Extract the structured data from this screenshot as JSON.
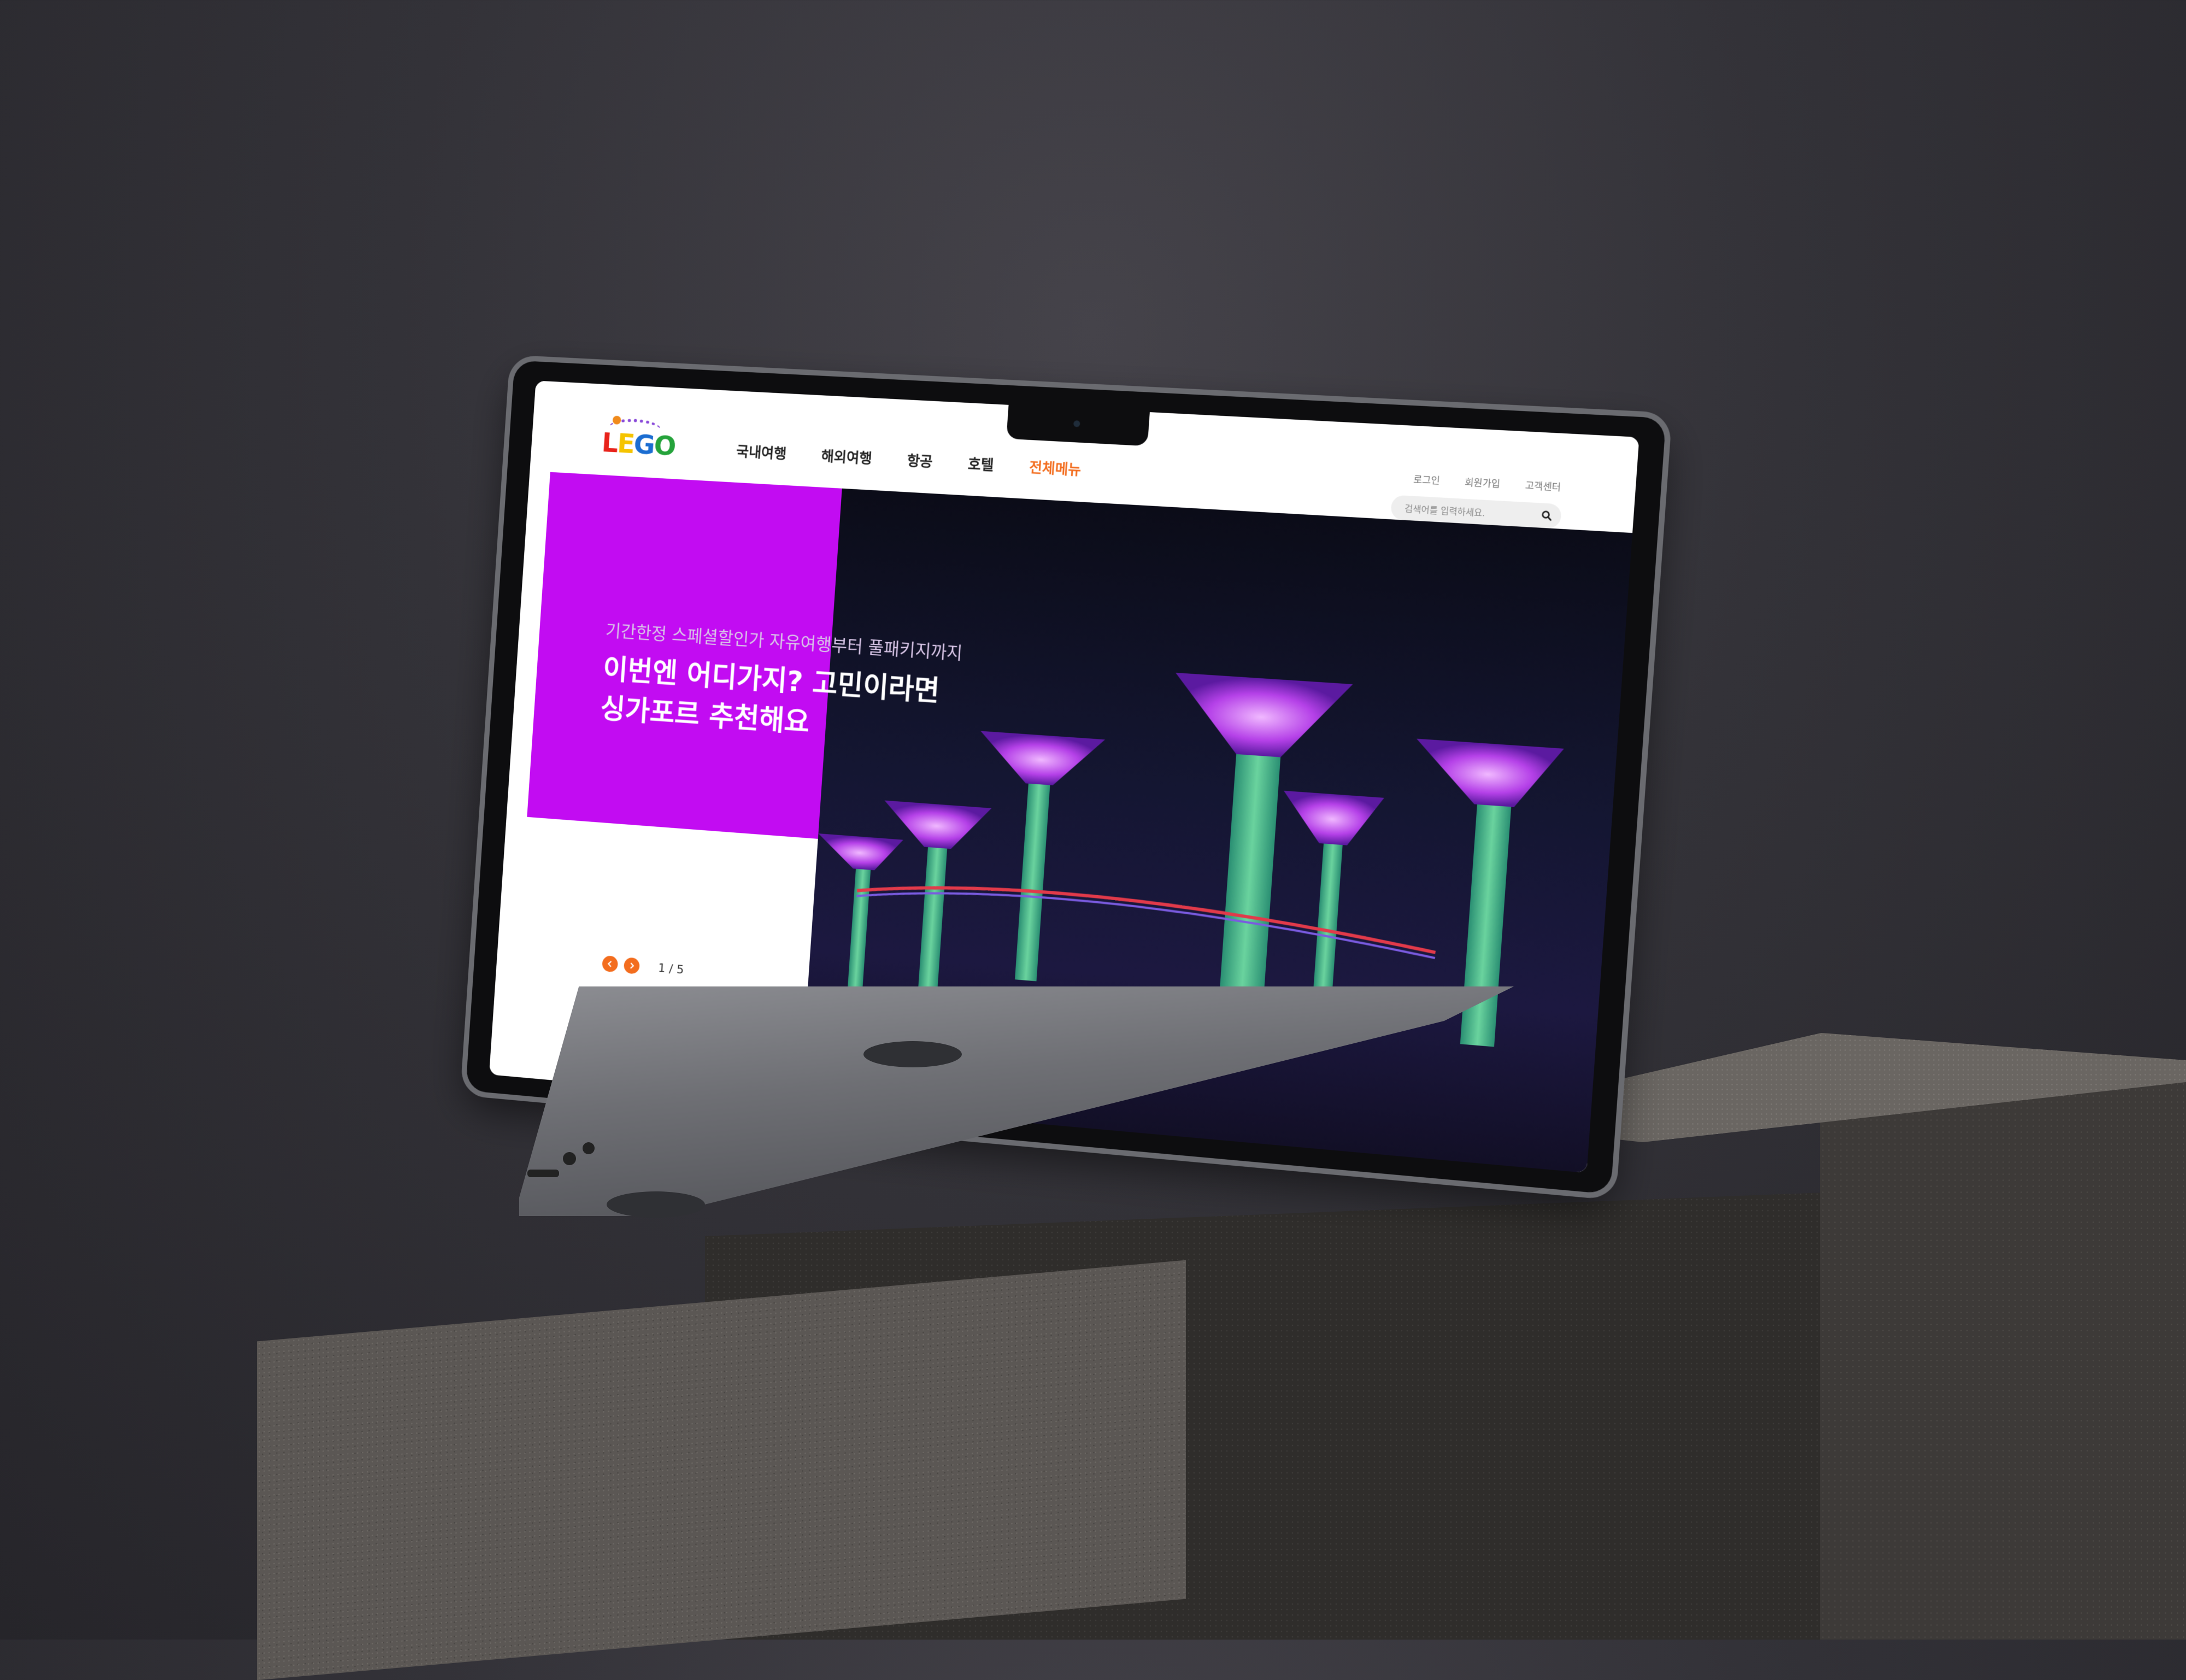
{
  "site": {
    "logo": {
      "letters": [
        "L",
        "E",
        "G",
        "O"
      ]
    },
    "nav": {
      "items": [
        {
          "label": "국내여행"
        },
        {
          "label": "해외여행"
        },
        {
          "label": "항공"
        },
        {
          "label": "호텔"
        },
        {
          "label": "전체메뉴"
        }
      ]
    },
    "util": {
      "login": "로그인",
      "signup": "회원가입",
      "support": "고객센터"
    },
    "search": {
      "placeholder": "검색어를 입력하세요."
    },
    "hero": {
      "subtitle": "기간한정 스페셜할인가 자유여행부터 풀패키지까지",
      "title_line1": "이번엔 어디가지? 고민이라면",
      "title_line2": "싱가포르 추천해요",
      "pagination": "1 / 5"
    }
  },
  "colors": {
    "accent": "#f36d1e",
    "hero_panel": "#c20cf2",
    "text_dark": "#222222"
  },
  "icons": [
    "chevron-left-icon",
    "chevron-right-icon",
    "search-icon"
  ]
}
